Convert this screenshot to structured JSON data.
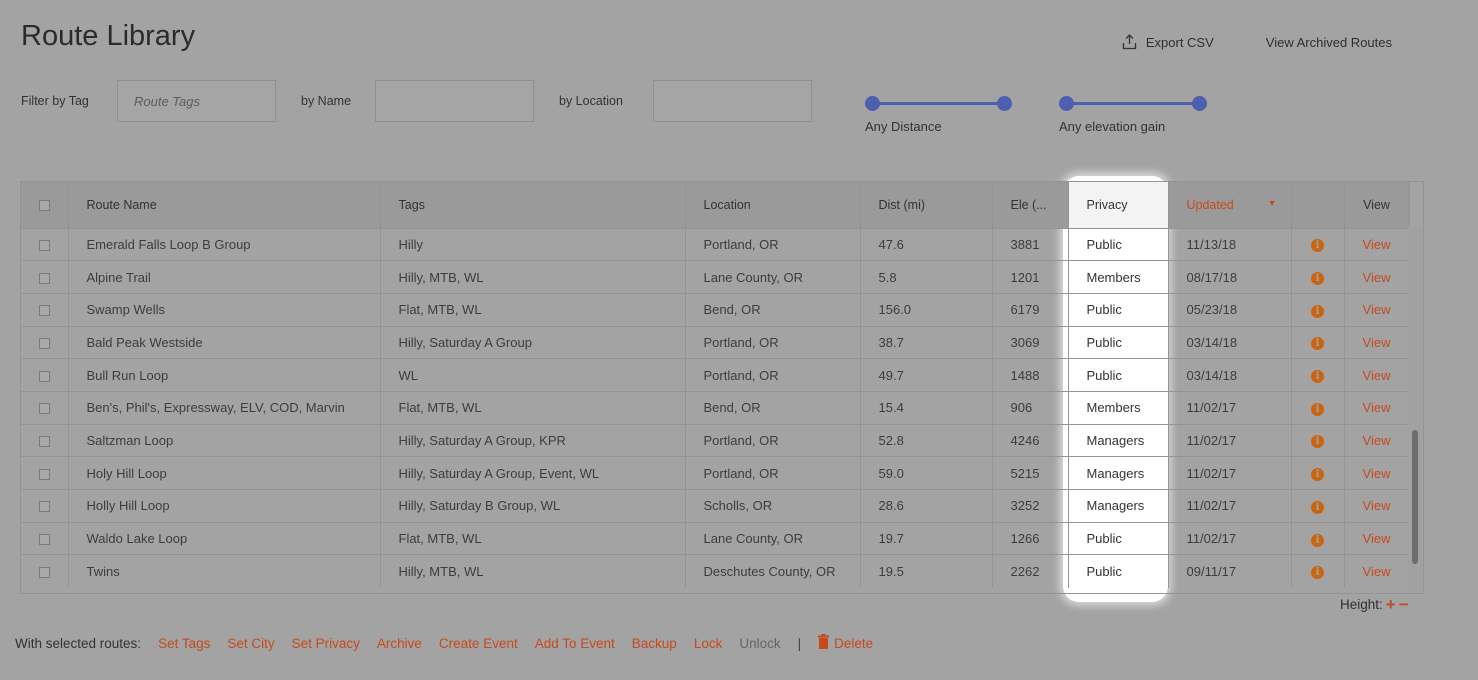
{
  "page": {
    "title": "Route Library"
  },
  "top_actions": {
    "export_csv": "Export CSV",
    "view_archived": "View Archived Routes"
  },
  "filters": {
    "tag_label": "Filter by Tag",
    "tag_placeholder": "Route Tags",
    "name_label": "by Name",
    "name_value": "",
    "location_label": "by Location",
    "location_value": ""
  },
  "sliders": {
    "distance_label": "Any Distance",
    "elevation_label": "Any elevation gain",
    "accent_color": "#4e5fb0"
  },
  "table": {
    "headers": {
      "route_name": "Route Name",
      "tags": "Tags",
      "location": "Location",
      "dist": "Dist (mi)",
      "ele": "Ele (...",
      "privacy": "Privacy",
      "updated": "Updated",
      "view": "View"
    },
    "sort": {
      "column": "Updated",
      "direction": "descending"
    },
    "view_label": "View",
    "rows": [
      {
        "name": "Emerald Falls Loop B Group",
        "tags": "Hilly",
        "location": "Portland, OR",
        "dist": "47.6",
        "ele": "3881",
        "privacy": "Public",
        "updated": "11/13/18"
      },
      {
        "name": "Alpine Trail",
        "tags": "Hilly, MTB, WL",
        "location": "Lane County, OR",
        "dist": "5.8",
        "ele": "1201",
        "privacy": "Members",
        "updated": "08/17/18"
      },
      {
        "name": "Swamp Wells",
        "tags": "Flat, MTB, WL",
        "location": "Bend, OR",
        "dist": "156.0",
        "ele": "6179",
        "privacy": "Public",
        "updated": "05/23/18"
      },
      {
        "name": "Bald Peak Westside",
        "tags": "Hilly, Saturday A Group",
        "location": "Portland, OR",
        "dist": "38.7",
        "ele": "3069",
        "privacy": "Public",
        "updated": "03/14/18"
      },
      {
        "name": "Bull Run Loop",
        "tags": "WL",
        "location": "Portland, OR",
        "dist": "49.7",
        "ele": "1488",
        "privacy": "Public",
        "updated": "03/14/18"
      },
      {
        "name": "Ben's, Phil's, Expressway, ELV, COD, Marvin",
        "tags": "Flat, MTB, WL",
        "location": "Bend, OR",
        "dist": "15.4",
        "ele": "906",
        "privacy": "Members",
        "updated": "11/02/17"
      },
      {
        "name": "Saltzman Loop",
        "tags": "Hilly, Saturday A Group, KPR",
        "location": "Portland, OR",
        "dist": "52.8",
        "ele": "4246",
        "privacy": "Managers",
        "updated": "11/02/17"
      },
      {
        "name": "Holy Hill Loop",
        "tags": "Hilly, Saturday A Group, Event, WL",
        "location": "Portland, OR",
        "dist": "59.0",
        "ele": "5215",
        "privacy": "Managers",
        "updated": "11/02/17"
      },
      {
        "name": "Holly Hill Loop",
        "tags": "Hilly, Saturday B Group, WL",
        "location": "Scholls, OR",
        "dist": "28.6",
        "ele": "3252",
        "privacy": "Managers",
        "updated": "11/02/17"
      },
      {
        "name": "Waldo Lake Loop",
        "tags": "Flat, MTB, WL",
        "location": "Lane County, OR",
        "dist": "19.7",
        "ele": "1266",
        "privacy": "Public",
        "updated": "11/02/17"
      },
      {
        "name": "Twins",
        "tags": "Hilly, MTB, WL",
        "location": "Deschutes County, OR",
        "dist": "19.5",
        "ele": "2262",
        "privacy": "Public",
        "updated": "09/11/17"
      }
    ]
  },
  "height_control": {
    "label": "Height:",
    "plus": "+",
    "minus": "−"
  },
  "bulk_actions": {
    "label": "With selected routes:",
    "set_tags": "Set Tags",
    "set_city": "Set City",
    "set_privacy": "Set Privacy",
    "archive": "Archive",
    "create_event": "Create Event",
    "add_to_event": "Add To Event",
    "backup": "Backup",
    "lock": "Lock",
    "unlock": "Unlock",
    "separator": "|",
    "delete": "Delete"
  },
  "icons": {
    "export": "upload-icon",
    "info": "info-icon",
    "delete": "trash-icon",
    "sort": "caret-down-icon"
  },
  "colors": {
    "accent": "#c64a1c",
    "info": "#c9650f",
    "slider": "#4e5fb0",
    "overlay": "#a3a3a3",
    "highlight": "#ffffff"
  }
}
